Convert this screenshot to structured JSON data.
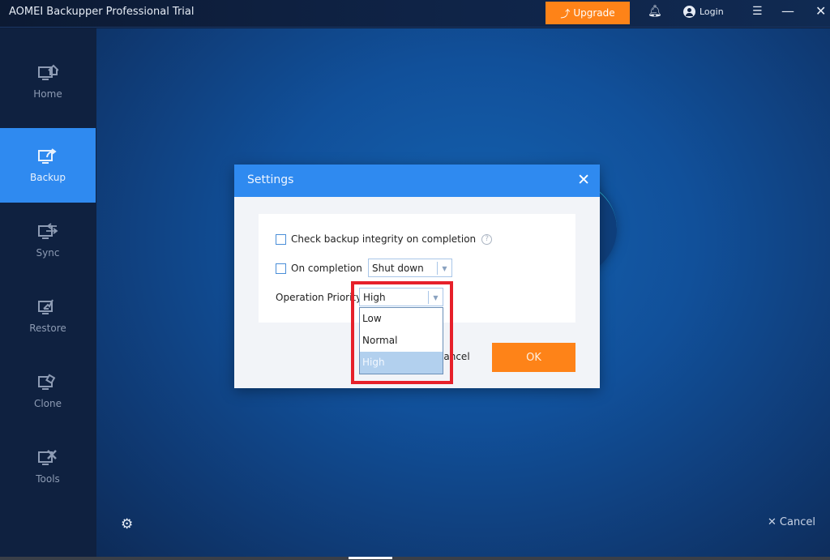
{
  "window": {
    "title": "AOMEI Backupper Professional Trial",
    "upgrade_label": "Upgrade",
    "login_label": "Login",
    "icons": [
      "upgrade-arrow-icon",
      "bell-icon",
      "user-icon",
      "menu-icon",
      "minimize-icon",
      "close-icon"
    ]
  },
  "sidebar": {
    "items": [
      {
        "label": "Home",
        "icon": "home-monitor-icon",
        "active": false
      },
      {
        "label": "Backup",
        "icon": "backup-monitor-icon",
        "active": true
      },
      {
        "label": "Sync",
        "icon": "sync-monitor-icon",
        "active": false
      },
      {
        "label": "Restore",
        "icon": "restore-monitor-icon",
        "active": false
      },
      {
        "label": "Clone",
        "icon": "clone-monitor-icon",
        "active": false
      },
      {
        "label": "Tools",
        "icon": "tools-monitor-icon",
        "active": false
      }
    ]
  },
  "footer": {
    "settings_icon": "gear-icon",
    "cancel_label": "Cancel"
  },
  "dialog": {
    "title": "Settings",
    "check_integrity_label": "Check backup integrity on completion",
    "check_integrity_checked": false,
    "on_completion_label": "On completion",
    "on_completion_checked": false,
    "on_completion_value": "Shut down",
    "priority_label": "Operation Priority",
    "priority_value": "High",
    "priority_options": [
      "Low",
      "Normal",
      "High"
    ],
    "priority_selected_index": 2,
    "cancel_label": "Cancel",
    "ok_label": "OK"
  },
  "colors": {
    "accent_blue": "#2f8af0",
    "orange": "#fe8318",
    "highlight_red": "#e6202a"
  }
}
